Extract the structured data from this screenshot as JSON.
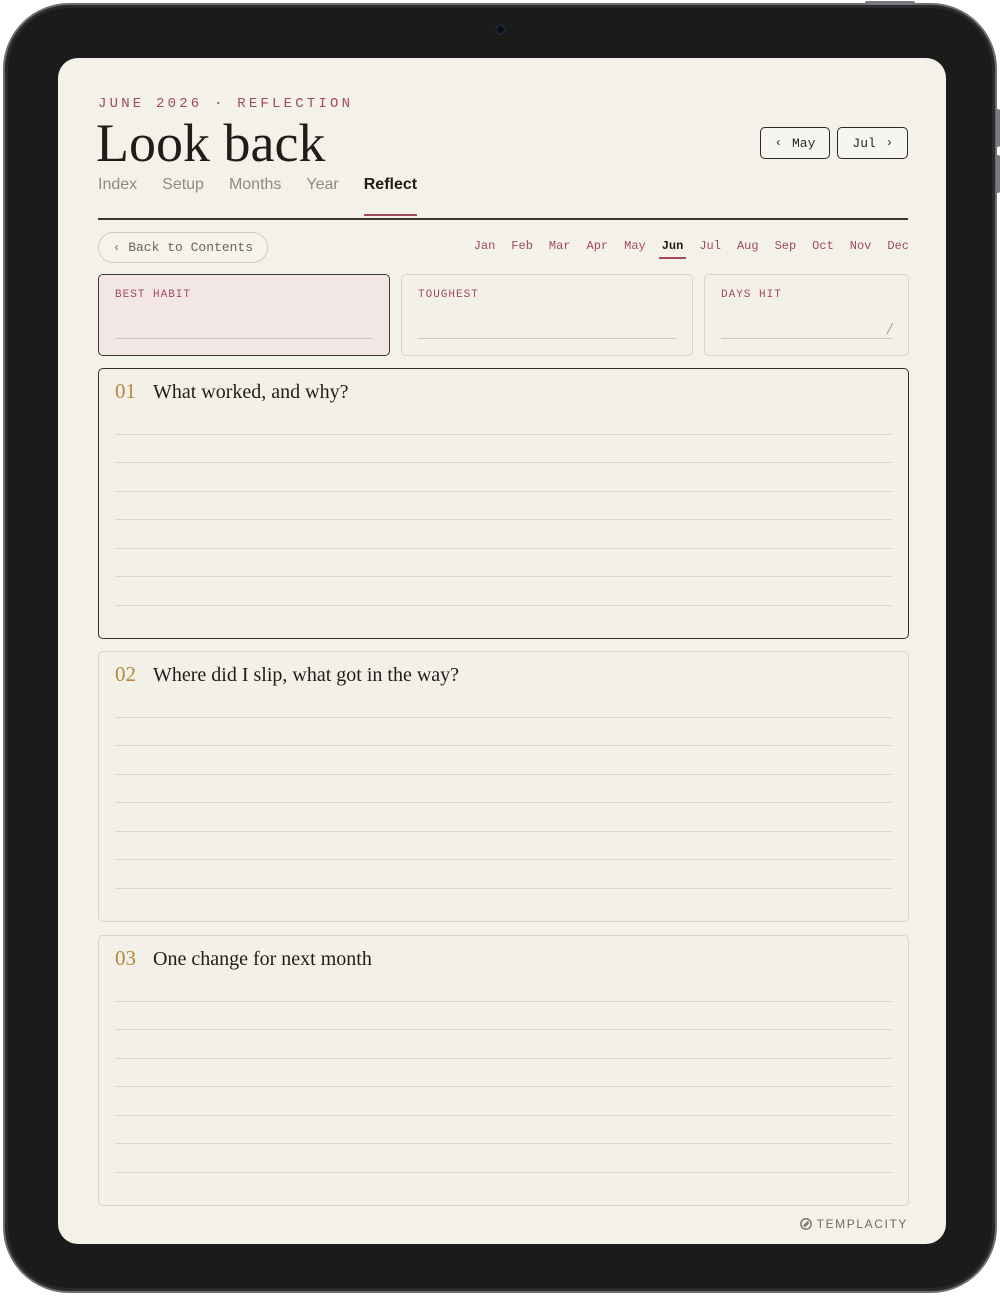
{
  "header": {
    "kicker": "JUNE 2026 · REFLECTION",
    "title": "Look back"
  },
  "nav": {
    "prev_label": "May",
    "next_label": "Jul",
    "prev_icon": "chevron-left-icon",
    "next_icon": "chevron-right-icon"
  },
  "tabs": [
    {
      "label": "Index"
    },
    {
      "label": "Setup"
    },
    {
      "label": "Months"
    },
    {
      "label": "Year"
    },
    {
      "label": "Reflect",
      "active": true
    }
  ],
  "back_link": {
    "label": "Back to Contents",
    "icon": "chevron-left-icon"
  },
  "months": [
    {
      "label": "Jan"
    },
    {
      "label": "Feb"
    },
    {
      "label": "Mar"
    },
    {
      "label": "Apr"
    },
    {
      "label": "May"
    },
    {
      "label": "Jun",
      "active": true
    },
    {
      "label": "Jul"
    },
    {
      "label": "Aug"
    },
    {
      "label": "Sep"
    },
    {
      "label": "Oct"
    },
    {
      "label": "Nov"
    },
    {
      "label": "Dec"
    }
  ],
  "stats": {
    "best_habit": {
      "label": "BEST HABIT",
      "value": ""
    },
    "toughest": {
      "label": "TOUGHEST",
      "value": ""
    },
    "days_hit": {
      "label": "DAYS HIT",
      "separator": "/"
    }
  },
  "questions": [
    {
      "number": "01",
      "text": "What worked, and why?"
    },
    {
      "number": "02",
      "text": "Where did I slip, what got in the way?"
    },
    {
      "number": "03",
      "text": "One change for next month"
    }
  ],
  "footer": {
    "brand": "TEMPLACITY",
    "brand_icon": "paperclip-icon"
  },
  "colors": {
    "accent": "#a04a5e",
    "number_gold": "#b8873f",
    "paper": "#f4f1e9",
    "ink": "#1f1d1a"
  }
}
